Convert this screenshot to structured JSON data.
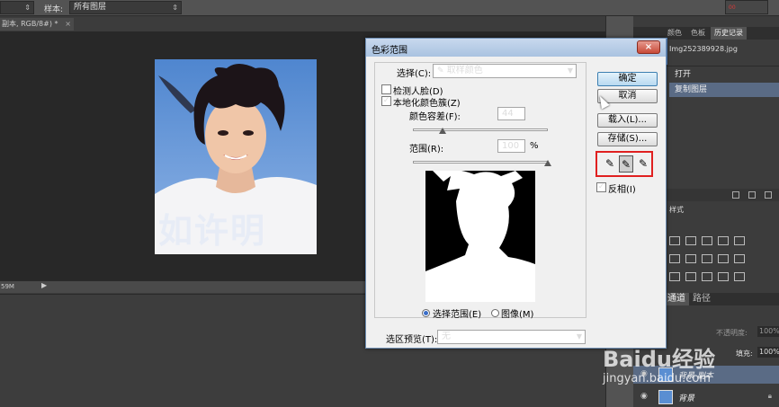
{
  "options_bar": {
    "tool_select_value": "",
    "sample_label": "样本:",
    "sample_value": "所有图层",
    "top_right_text": "00"
  },
  "document": {
    "tab_title": "副本, RGB/8#) *",
    "tab_close": "×",
    "zoom_status": "59M",
    "photo_watermark_text": "如许明"
  },
  "right_panel": {
    "tabs": [
      "颜色",
      "色板",
      "历史记录"
    ],
    "history_source": "Img252389928.jpg",
    "history_items": [
      "打开",
      "复制图层"
    ],
    "adjust_tab": "样式",
    "layer_tabs": [
      "通道",
      "路径"
    ],
    "opacity_label": "不透明度:",
    "opacity_value": "100%",
    "fill_label": "填充:",
    "fill_value": "100%",
    "layers": [
      {
        "name": "背景 副本"
      },
      {
        "name": "背景"
      }
    ]
  },
  "dialog": {
    "title": "色彩范围",
    "close": "×",
    "select_label": "选择(C):",
    "select_value": "取样颜色",
    "detect_faces": "检测人脸(D)",
    "detect_faces_checked": false,
    "localized_clusters": "本地化颜色簇(Z)",
    "localized_clusters_checked": true,
    "fuzziness_label": "颜色容差(F):",
    "fuzziness_value": "44",
    "fuzziness_fraction": 0.22,
    "range_label": "范围(R):",
    "range_value": "100",
    "range_unit": "%",
    "range_fraction": 1.0,
    "radio_selection": "选择范围(E)",
    "radio_image": "图像(M)",
    "preview_label": "选区预览(T):",
    "preview_value": "无",
    "ok": "确定",
    "cancel": "取消",
    "load": "载入(L)...",
    "save": "存储(S)...",
    "invert": "反相(I)",
    "invert_checked": true
  },
  "watermark": {
    "logo": "Baidu经验",
    "url": "jingyan.baidu.com"
  }
}
